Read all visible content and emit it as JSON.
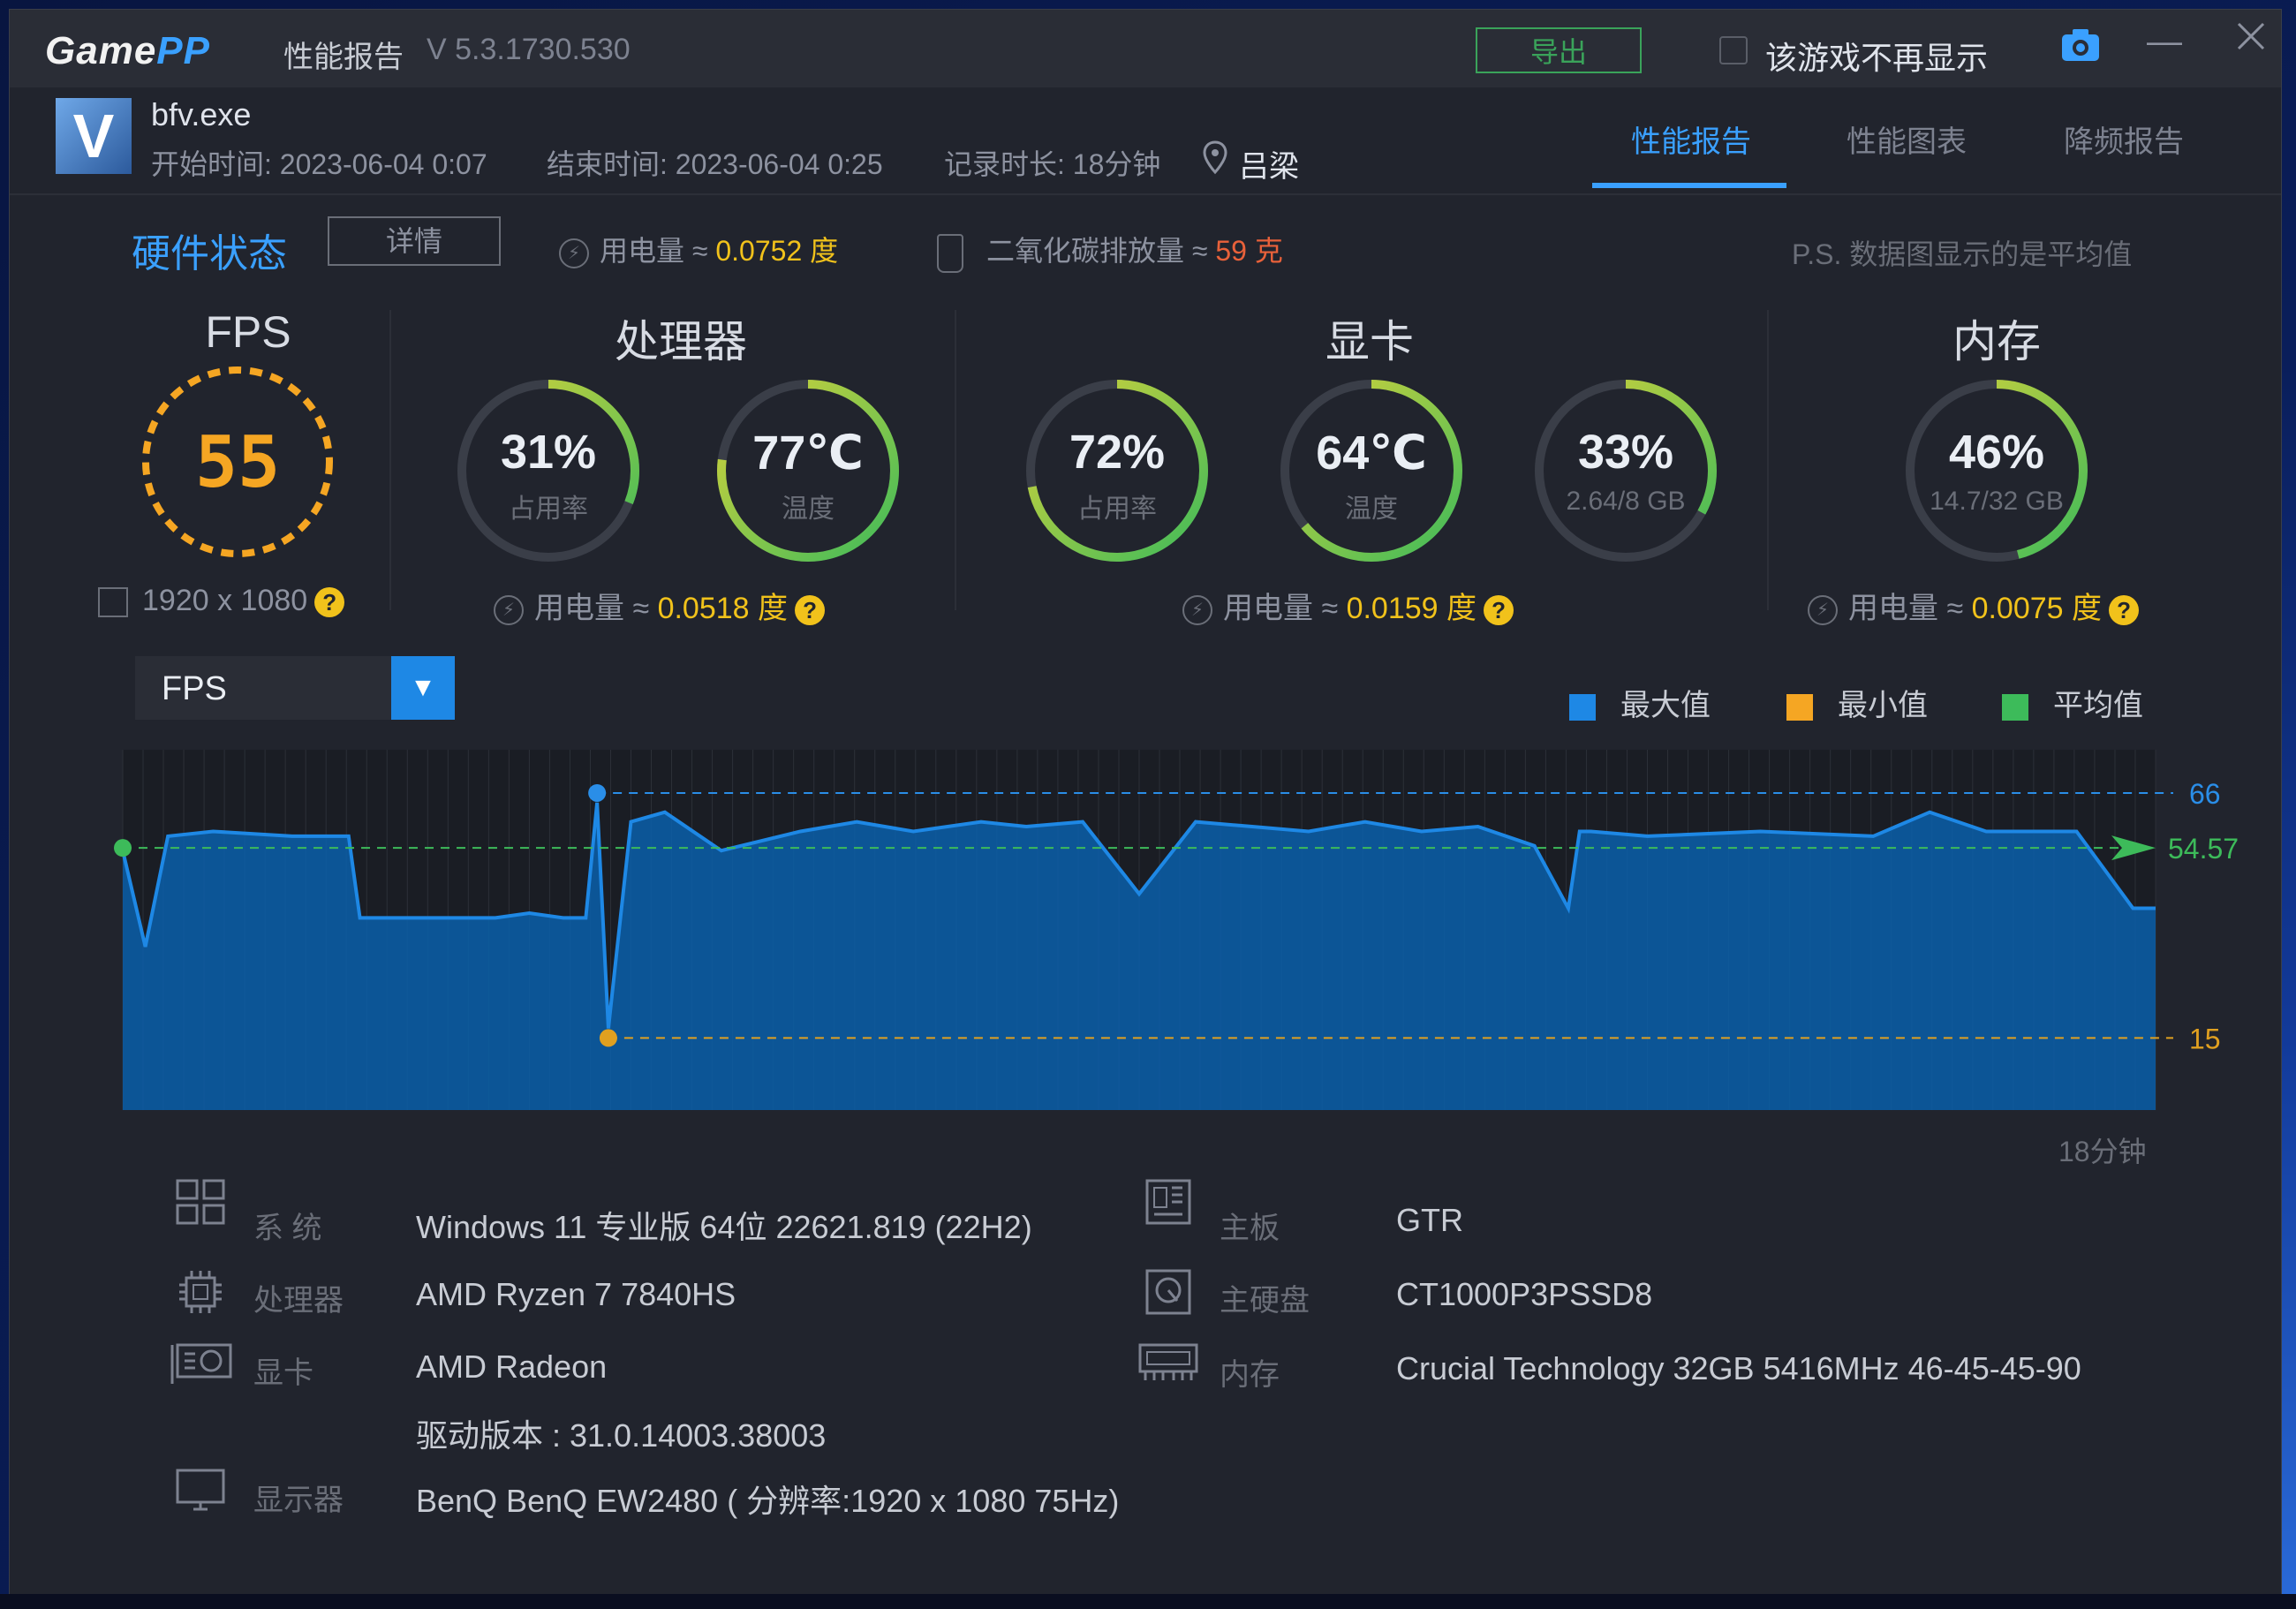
{
  "titlebar": {
    "logo_part1": "Game",
    "logo_part2": "PP",
    "title": "性能报告",
    "version": "V 5.3.1730.530",
    "export_label": "导出",
    "hide_game_label": "该游戏不再显示"
  },
  "header": {
    "exe_name": "bfv.exe",
    "icon_letter": "V",
    "start_time": "开始时间: 2023-06-04 0:07",
    "end_time": "结束时间: 2023-06-04 0:25",
    "duration": "记录时长: 18分钟",
    "location": "吕梁",
    "tabs": [
      {
        "label": "性能报告",
        "active": true
      },
      {
        "label": "性能图表",
        "active": false
      },
      {
        "label": "降频报告",
        "active": false
      }
    ]
  },
  "hardware": {
    "title": "硬件状态",
    "detail_button": "详情",
    "power_label": "用电量 ≈ ",
    "power_value": "0.0752 度",
    "co2_label": "二氧化碳排放量 ≈ ",
    "co2_value": "59 克",
    "note": "P.S. 数据图显示的是平均值",
    "fps": {
      "title": "FPS",
      "value": "55",
      "resolution": "1920 x 1080"
    },
    "cpu": {
      "title": "处理器",
      "usage": "31%",
      "usage_label": "占用率",
      "usage_frac": 0.31,
      "temp": "77℃",
      "temp_label": "温度",
      "temp_frac": 0.77,
      "power_label": "用电量 ≈ ",
      "power_value": "0.0518 度"
    },
    "gpu": {
      "title": "显卡",
      "usage": "72%",
      "usage_label": "占用率",
      "usage_frac": 0.72,
      "temp": "64℃",
      "temp_label": "温度",
      "temp_frac": 0.64,
      "vram": "33%",
      "vram_label": "2.64/8 GB",
      "vram_frac": 0.33,
      "power_label": "用电量 ≈ ",
      "power_value": "0.0159 度"
    },
    "memory": {
      "title": "内存",
      "usage": "46%",
      "usage_label": "14.7/32 GB",
      "usage_frac": 0.46,
      "power_label": "用电量 ≈ ",
      "power_value": "0.0075 度"
    }
  },
  "chart_controls": {
    "selected_metric": "FPS",
    "legend": [
      {
        "label": "最大值",
        "color": "#1e88e5"
      },
      {
        "label": "最小值",
        "color": "#f5a623"
      },
      {
        "label": "平均值",
        "color": "#3dbb5a"
      }
    ]
  },
  "chart_data": {
    "type": "area",
    "metric": "FPS",
    "xlabel": "18分钟",
    "ylim": [
      0,
      75
    ],
    "max": 66,
    "min": 15,
    "avg": 54.57,
    "max_label": "66",
    "min_label": "15",
    "avg_label": "54.57",
    "x": [
      0.0,
      0.2,
      0.4,
      0.8,
      1.5,
      2.0,
      2.1,
      2.8,
      3.3,
      3.6,
      3.9,
      4.1,
      4.2,
      4.3,
      4.5,
      4.8,
      5.3,
      6.0,
      6.5,
      7.0,
      7.6,
      8.0,
      8.5,
      9.0,
      9.5,
      10.0,
      10.5,
      11.0,
      11.5,
      12.0,
      12.5,
      12.8,
      12.9,
      13.0,
      13.5,
      14.5,
      15.5,
      16.0,
      16.5,
      17.3,
      17.8,
      17.9,
      18.0
    ],
    "values": [
      54,
      34,
      57,
      58,
      57,
      57,
      40,
      40,
      40,
      41,
      40,
      40,
      64,
      17,
      60,
      62,
      54,
      58,
      60,
      58,
      60,
      59,
      60,
      45,
      60,
      59,
      58,
      60,
      58,
      59,
      55,
      42,
      58,
      58,
      57,
      58,
      57,
      62,
      58,
      58,
      42,
      42,
      42
    ],
    "colors": {
      "area": "#0b5faa",
      "line": "#1e88e5",
      "max": "#2a8ee8",
      "min": "#e0a020",
      "avg": "#3dbb5a"
    }
  },
  "system": {
    "os_label": "系  统",
    "os": "Windows 11 专业版 64位 22621.819 (22H2)",
    "cpu_label": "处理器",
    "cpu": "AMD Ryzen 7 7840HS",
    "gpu_label": "显卡",
    "gpu": "AMD Radeon",
    "driver": "驱动版本 : 31.0.14003.38003",
    "display_label": "显示器",
    "display": "BenQ BenQ EW2480 ( 分辨率:1920 x 1080 75Hz)",
    "board_label": "主板",
    "board": "GTR",
    "disk_label": "主硬盘",
    "disk": "CT1000P3PSSD8",
    "mem_label": "内存",
    "mem": "Crucial Technology 32GB 5416MHz 46-45-45-90"
  }
}
